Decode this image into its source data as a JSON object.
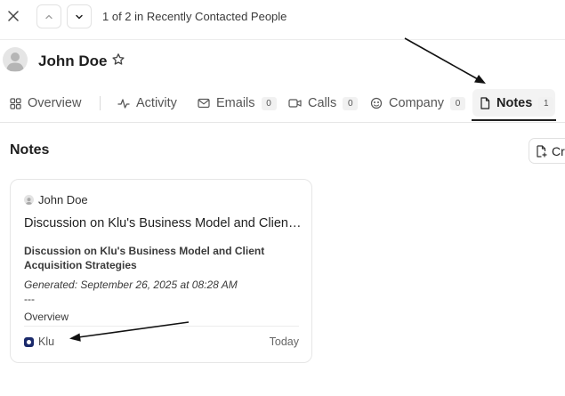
{
  "topbar": {
    "pager_text": "1 of 2 in Recently Contacted People"
  },
  "person": {
    "name": "John Doe"
  },
  "tabs": [
    {
      "label": "Overview",
      "count": ""
    },
    {
      "label": "Activity",
      "count": ""
    },
    {
      "label": "Emails",
      "count": "0"
    },
    {
      "label": "Calls",
      "count": "0"
    },
    {
      "label": "Company",
      "count": "0"
    },
    {
      "label": "Notes",
      "count": "1"
    }
  ],
  "section": {
    "title": "Notes",
    "create_label": "Cr"
  },
  "note": {
    "author": "John Doe",
    "title": "Discussion on Klu's Business Model and Client Acquisition Strategies",
    "body_heading": "Discussion on Klu's Business Model and Client Acquisition Strategies",
    "body_generated": "Generated: September 26, 2025 at 08:28 AM",
    "body_rule": "---",
    "body_next": "Overview",
    "org": "Klu",
    "date": "Today"
  },
  "colors": {
    "accent_dark": "#1f1f1f",
    "org_logo": "#1b2a6b",
    "border": "#e6e6e6"
  }
}
